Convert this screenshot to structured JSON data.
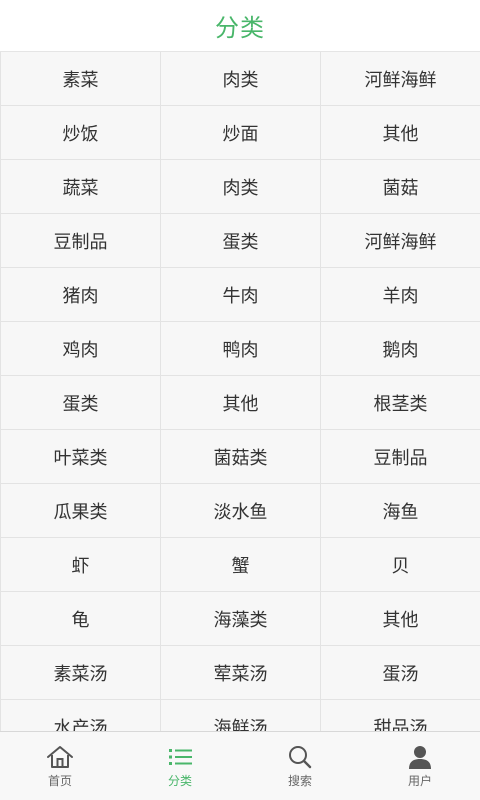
{
  "header": {
    "title": "分类"
  },
  "categories": [
    [
      "素菜",
      "肉类",
      "河鲜海鲜"
    ],
    [
      "炒饭",
      "炒面",
      "其他"
    ],
    [
      "蔬菜",
      "肉类",
      "菌菇"
    ],
    [
      "豆制品",
      "蛋类",
      "河鲜海鲜"
    ],
    [
      "猪肉",
      "牛肉",
      "羊肉"
    ],
    [
      "鸡肉",
      "鸭肉",
      "鹅肉"
    ],
    [
      "蛋类",
      "其他",
      "根茎类"
    ],
    [
      "叶菜类",
      "菌菇类",
      "豆制品"
    ],
    [
      "瓜果类",
      "淡水鱼",
      "海鱼"
    ],
    [
      "虾",
      "蟹",
      "贝"
    ],
    [
      "龟",
      "海藻类",
      "其他"
    ],
    [
      "素菜汤",
      "荤菜汤",
      "蛋汤"
    ],
    [
      "水产汤",
      "海鲜汤",
      "甜品汤"
    ]
  ],
  "tabbar": {
    "items": [
      {
        "label": "首页",
        "icon": "home-icon",
        "active": false
      },
      {
        "label": "分类",
        "icon": "list-icon",
        "active": true
      },
      {
        "label": "搜索",
        "icon": "search-icon",
        "active": false
      },
      {
        "label": "用户",
        "icon": "user-icon",
        "active": false
      }
    ]
  },
  "colors": {
    "accent": "#49b66a",
    "text": "#333333",
    "tab_inactive": "#666666",
    "cell_bg": "#f7f7f7",
    "border": "#e3e3e3"
  }
}
